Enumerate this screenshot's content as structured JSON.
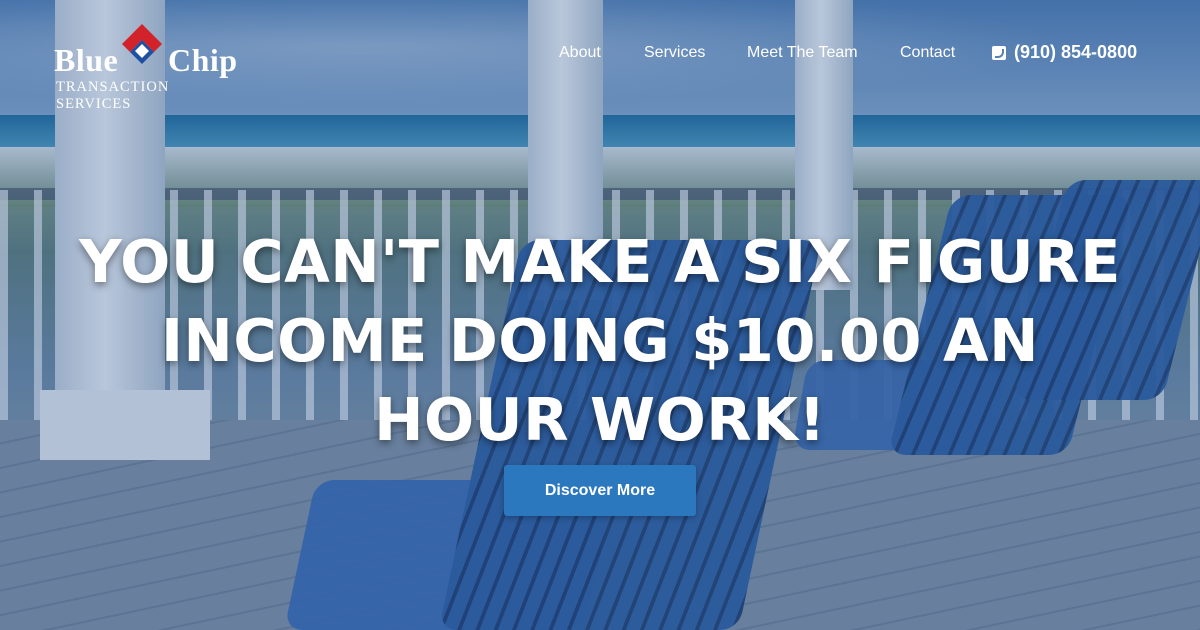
{
  "brand": {
    "name_part1": "Blue",
    "name_part2": "Chip",
    "tagline": "TRANSACTION SERVICES",
    "logo_icon": "diamond-logo-mark",
    "colors": {
      "primary": "#2c78be",
      "logo_red": "#d2232a",
      "logo_blue": "#1f4fa0"
    }
  },
  "nav": {
    "items": [
      {
        "label": "About"
      },
      {
        "label": "Services"
      },
      {
        "label": "Meet The Team"
      },
      {
        "label": "Contact"
      }
    ],
    "phone": {
      "icon": "phone-square-icon",
      "number": "(910) 854-0800"
    }
  },
  "hero": {
    "headline": "YOU CAN'T MAKE A SIX FIGURE INCOME DOING $10.00 AN HOUR WORK!",
    "cta_label": "Discover More",
    "background": "beach-porch-photo"
  }
}
